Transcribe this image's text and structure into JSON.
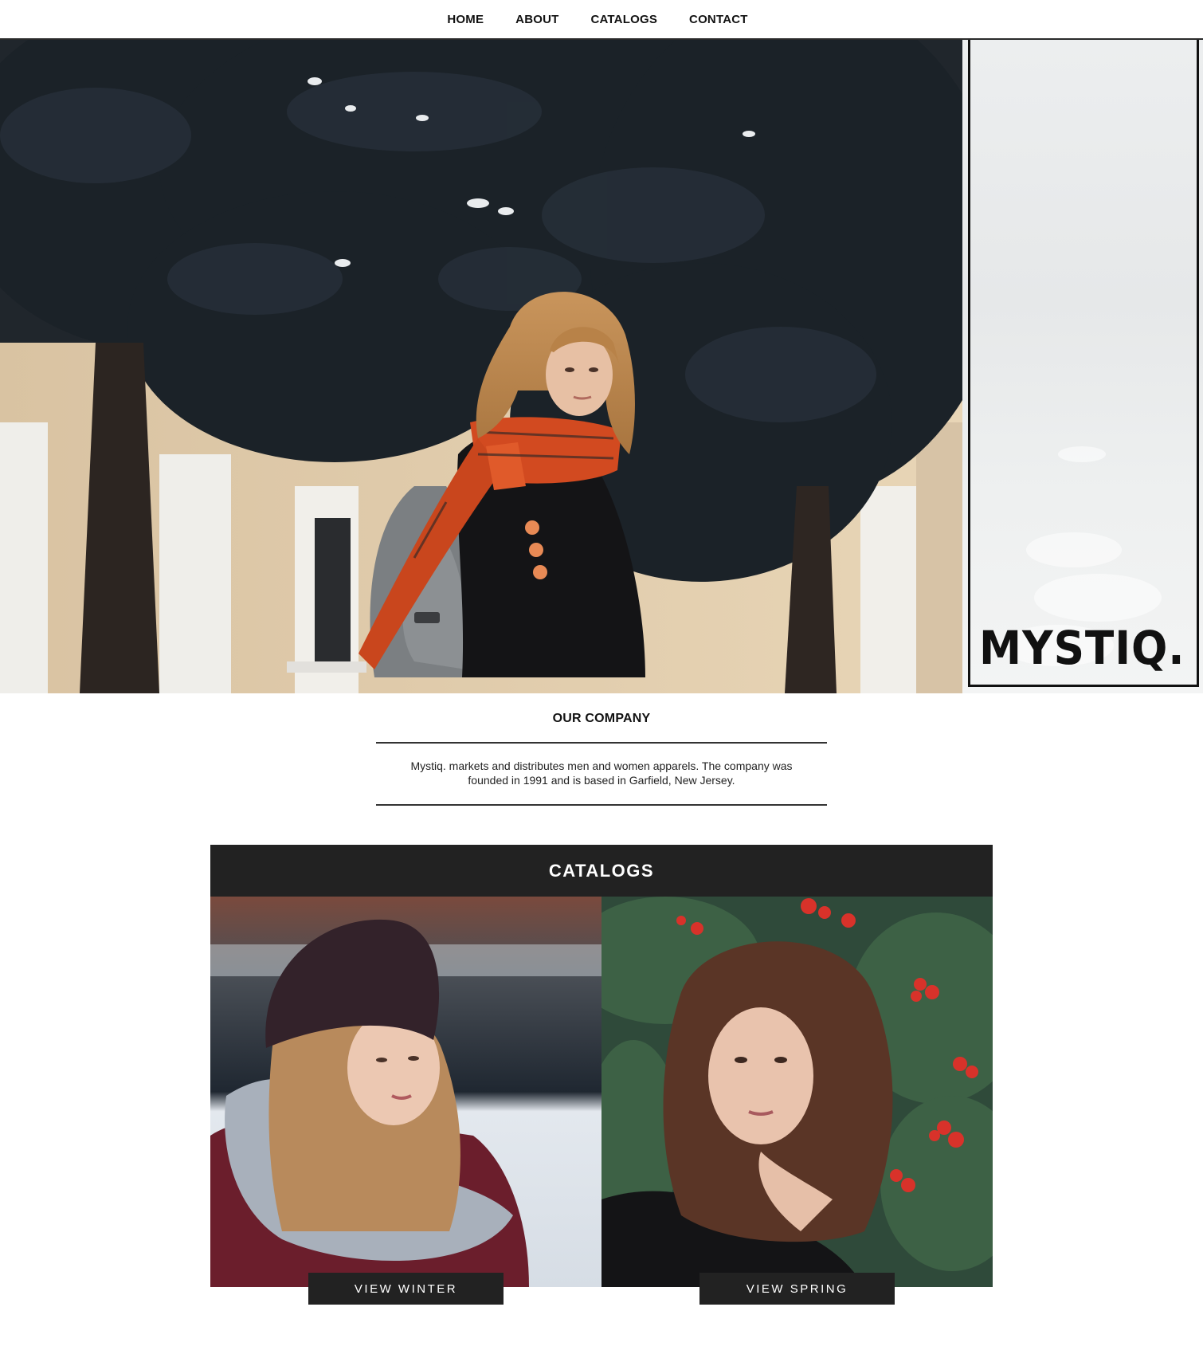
{
  "nav": {
    "items": [
      {
        "label": "HOME"
      },
      {
        "label": "ABOUT"
      },
      {
        "label": "CATALOGS"
      },
      {
        "label": "CONTACT"
      }
    ]
  },
  "hero": {
    "brand": "MYSTIQ."
  },
  "company": {
    "title": "OUR COMPANY",
    "description": "Mystiq. markets and distributes men and women apparels. The company was founded in 1991 and is based in Garfield, New Jersey."
  },
  "catalogs": {
    "title": "CATALOGS",
    "cards": [
      {
        "button_label": "VIEW WINTER"
      },
      {
        "button_label": "VIEW SPRING"
      }
    ]
  },
  "colors": {
    "dark_bar": "#222222",
    "text": "#111111",
    "background": "#ffffff"
  }
}
